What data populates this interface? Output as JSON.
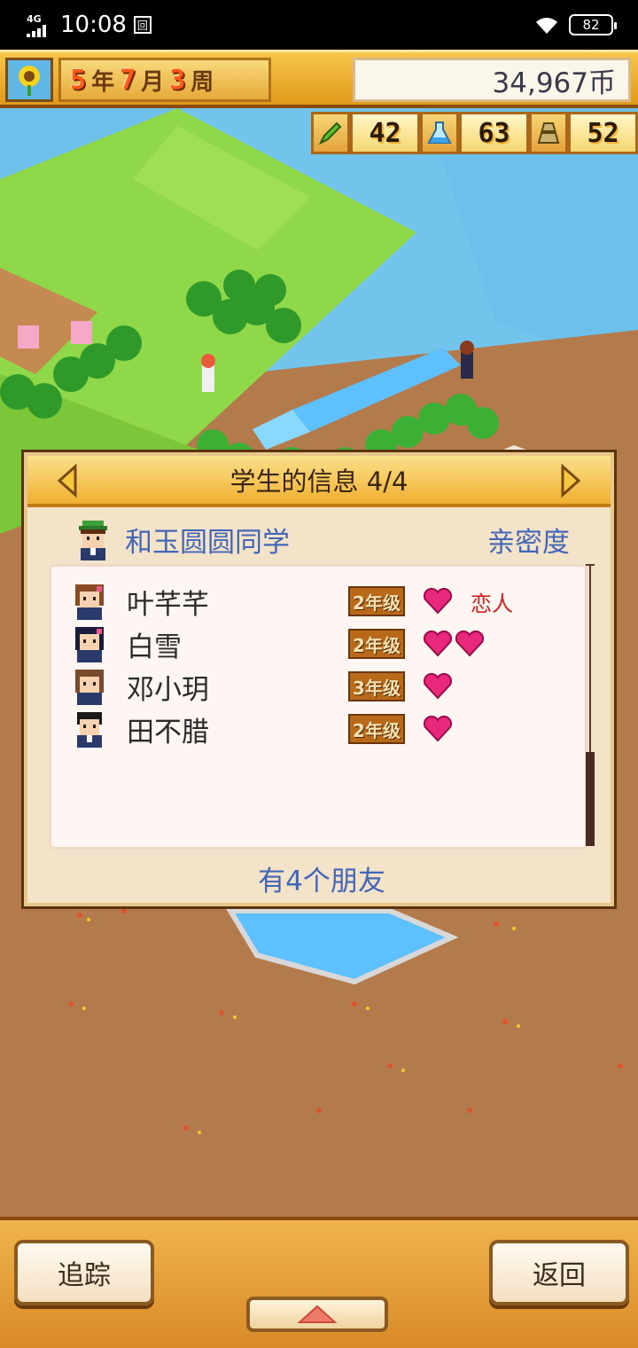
{
  "status_bar": {
    "network": "4G",
    "time": "10:08",
    "battery": "82"
  },
  "hud": {
    "year": "5",
    "year_unit": "年",
    "month": "7",
    "month_unit": "月",
    "week": "3",
    "week_unit": "周",
    "money": "34,967币",
    "stats": [
      {
        "icon": "pencil-icon",
        "value": "42"
      },
      {
        "icon": "flask-icon",
        "value": "63"
      },
      {
        "icon": "weight-icon",
        "value": "52"
      }
    ]
  },
  "panel": {
    "title": "学生的信息 4/4",
    "student_name": "和玉圆圆同学",
    "intimacy_label": "亲密度",
    "friends": [
      {
        "name": "叶芊芊",
        "grade": "2年级",
        "hearts": 1,
        "relation": "恋人"
      },
      {
        "name": "白雪",
        "grade": "2年级",
        "hearts": 2,
        "relation": ""
      },
      {
        "name": "邓小玥",
        "grade": "3年级",
        "hearts": 1,
        "relation": ""
      },
      {
        "name": "田不腊",
        "grade": "2年级",
        "hearts": 1,
        "relation": ""
      }
    ],
    "friend_count": "有4个朋友"
  },
  "bottom_bar": {
    "track_label": "追踪",
    "back_label": "返回"
  },
  "colors": {
    "accent_blue": "#4466b8",
    "heart_pink": "#e8287a",
    "relation_red": "#d42020",
    "hud_orange": "#f0b030"
  }
}
